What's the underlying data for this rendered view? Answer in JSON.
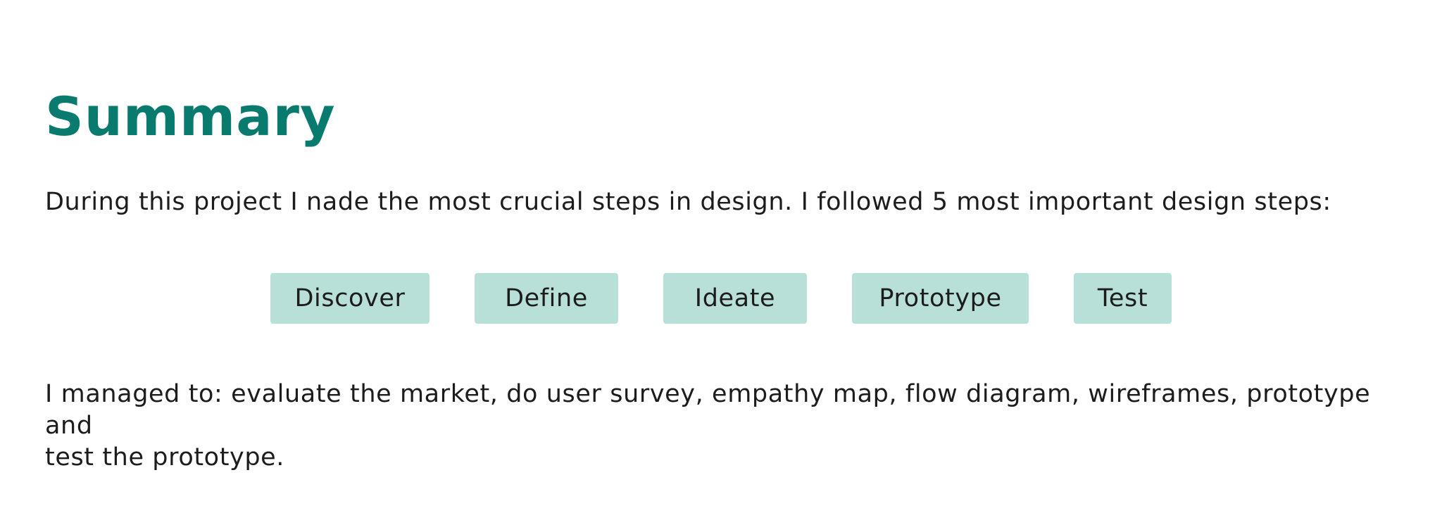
{
  "heading": {
    "title": "Summary"
  },
  "intro_text": "During this project I nade the most crucial steps in design. I followed 5 most important design steps:",
  "steps": [
    {
      "label": "Discover"
    },
    {
      "label": "Define"
    },
    {
      "label": "Ideate"
    },
    {
      "label": "Prototype"
    },
    {
      "label": "Test"
    }
  ],
  "outcome": {
    "line1": "I managed to: evaluate the market, do user survey, empathy map, flow diagram, wireframes, prototype and",
    "line2": "test the prototype."
  },
  "colors": {
    "title": "#087a6e",
    "step_background": "#b8e0d8",
    "body_text": "#1c1c1c",
    "page_background": "#ffffff"
  }
}
